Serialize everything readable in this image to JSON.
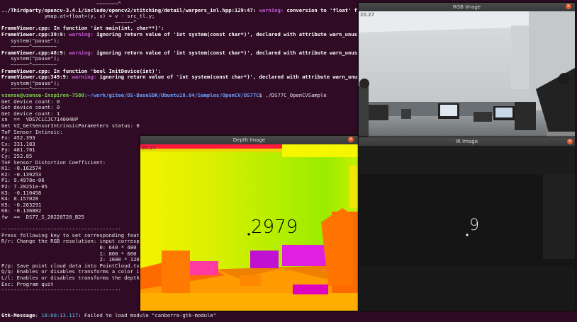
{
  "terminal": {
    "lines": [
      {
        "t": "                               ~~~~~~~^"
      },
      {
        "pre": "../Thirdparty/opencv-3.4.1/include/opencv2/stitching/detail/warpers_inl.hpp:129:47: ",
        "warn": "warning: ",
        "post": "conversion to 'float' fr"
      },
      {
        "t": "              ymap.at<float>(y, x) = v - src_tl.y;"
      },
      {
        "t": "                                     ~~~~~~^"
      },
      {
        "pre": "FrameViewer.cpp: In function 'int main(int, char**)':"
      },
      {
        "pre": "FrameViewer.cpp:39:9: ",
        "warn": "warning: ",
        "post": "ignoring return value of 'int system(const char*)', declared with attribute warn_unus"
      },
      {
        "t": "   system(\"pause\");"
      },
      {
        "t": "   ~~~~~~^~~~~~~~~"
      },
      {
        "pre": "FrameViewer.cpp:48:9: ",
        "warn": "warning: ",
        "post": "ignoring return value of 'int system(const char*)', declared with attribute warn_unus"
      },
      {
        "t": "   system(\"pause\");"
      },
      {
        "t": "   ~~~~~~^~~~~~~~~"
      },
      {
        "pre": "FrameViewer.cpp: In function 'bool InitDevice(int)':"
      },
      {
        "pre": "FrameViewer.cpp:349:9: ",
        "warn": "warning: ",
        "post": "ignoring return value of 'int system(const char*)', declared with attribute warn_unus"
      },
      {
        "t": "   system(\"pause\");"
      },
      {
        "t": "   ~~~~~~^~~~~~~~~"
      },
      {
        "prompt_user": "vzense@vzense-Inspiron-7580",
        "prompt_path": ":~/work/gitee/DS-BaseSDK/Ubuntu18.04/Samples/OpenCV/DS77C",
        "cmd": "$ ./DS77C_OpenCVSample"
      },
      {
        "t": "Get device count: 0"
      },
      {
        "t": "Get device count: 0"
      },
      {
        "t": "Get device count: 1"
      },
      {
        "t": "sn  ==  VDS7CLCJC7140040P"
      },
      {
        "t": "Get VZ_GetSensorIntrinsicParameters status: 0"
      },
      {
        "t": "ToF Sensor Intinsic:"
      },
      {
        "t": "Fx: 452.393"
      },
      {
        "t": "Cx: 331.183"
      },
      {
        "t": "Fy: 481.701"
      },
      {
        "t": "Cy: 252.85"
      },
      {
        "t": "ToF Sensor Distortion Coefficient:"
      },
      {
        "t": "K1: -0.162574"
      },
      {
        "t": "K2: -0.139253"
      },
      {
        "t": "P1: 9.4978e-06"
      },
      {
        "t": "P2: 7.20251e-05"
      },
      {
        "t": "K3: -0.110458"
      },
      {
        "t": "K4: 0.157028"
      },
      {
        "t": "K5: -0.263291"
      },
      {
        "t": "K6: -0.136882"
      },
      {
        "t": "fw  ==  DS77_S_20220720_B25"
      },
      {
        "t": ""
      },
      {
        "t": "---------------------------------------"
      },
      {
        "t": "Press following key to set corresponding feat"
      },
      {
        "t": "R/r: Change the RGB resolution: input correspo"
      },
      {
        "t": "                                0: 640 * 480"
      },
      {
        "t": "                                1: 800 * 600"
      },
      {
        "t": "                                2: 1600 * 1200"
      },
      {
        "t": "P/p: Save point cloud data into PointCloud.tx"
      },
      {
        "t": "Q/q: Enables or disables transforms a color i"
      },
      {
        "t": "L/l: Enables or disables transforms the depth"
      },
      {
        "t": "Esc: Program quit"
      },
      {
        "t": "---------------------------------------"
      }
    ],
    "gtk": {
      "name": "Gtk-Message",
      "time": "18:00:13.117",
      "msg": "Failed to load module \"canberra-gtk-module\""
    }
  },
  "windows": {
    "rgb": {
      "title": "RGB Image",
      "timestamp": "20.27",
      "close": "×"
    },
    "depth": {
      "title": "Depth Image",
      "timestamp": "20.27",
      "reading": "2979",
      "close": "×"
    },
    "ir": {
      "title": "IR Image",
      "reading": "9",
      "close": "×"
    }
  },
  "colors": {
    "terminal_bg": "#2f0b25",
    "warning": "#c25ad6",
    "prompt_user": "#7bd34a",
    "prompt_path": "#6aa2ff"
  }
}
